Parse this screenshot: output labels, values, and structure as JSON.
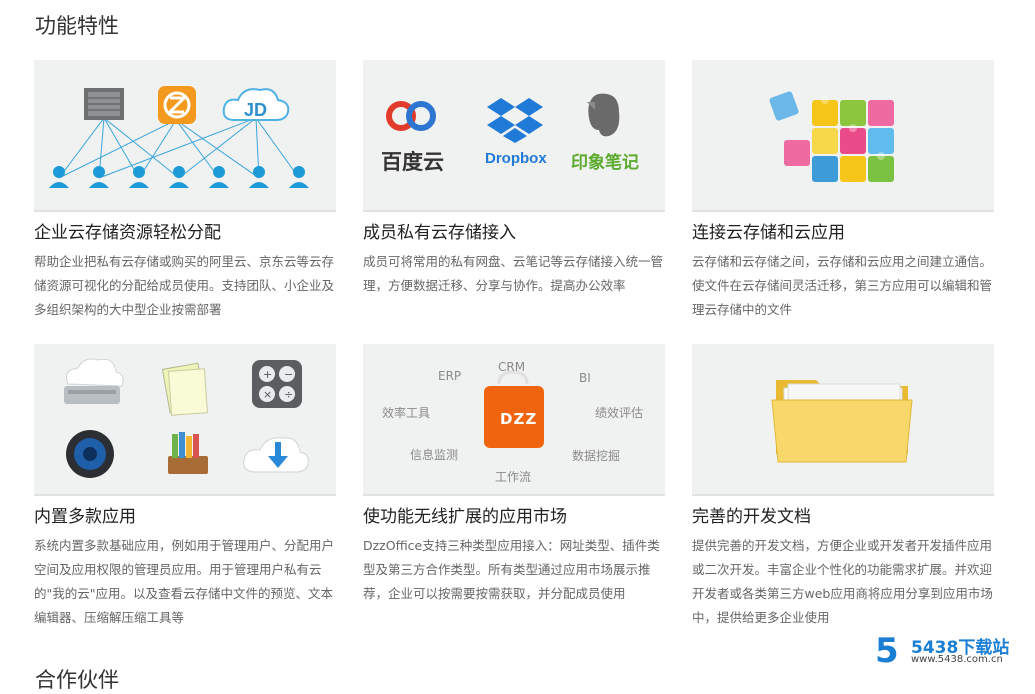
{
  "section_title": "功能特性",
  "cards": [
    {
      "title": "企业云存储资源轻松分配",
      "desc": "帮助企业把私有云存储或购买的阿里云、京东云等云存储资源可视化的分配给成员使用。支持团队、小企业及多组织架构的大中型企业按需部署",
      "image": {
        "icons": [
          "server-icon",
          "dzz-icon",
          "jd-cloud-icon",
          "user-icon"
        ],
        "logo_text": "JD"
      }
    },
    {
      "title": "成员私有云存储接入",
      "desc": "成员可将常用的私有网盘、云笔记等云存储接入统一管理，方便数据迁移、分享与协作。提高办公效率",
      "image": {
        "logos": [
          {
            "name": "baidu-cloud-logo",
            "text": "百度云",
            "color": "#333333"
          },
          {
            "name": "dropbox-logo",
            "text": "Dropbox",
            "color": "#1f7ad8"
          },
          {
            "name": "evernote-logo",
            "text": "印象笔记",
            "color": "#5cab2e"
          }
        ]
      }
    },
    {
      "title": "连接云存储和云应用",
      "desc": "云存储和云存储之间，云存储和云应用之间建立通信。使文件在云存储间灵活迁移，第三方应用可以编辑和管理云存储中的文件",
      "image": {
        "icons": [
          "puzzle-icon"
        ]
      }
    },
    {
      "title": "内置多款应用",
      "desc": "系统内置多款基础应用，例如用于管理用户、分配用户空间及应用权限的管理员应用。用于管理用户私有云的\"我的云\"应用。以及查看云存储中文件的预览、文本编辑器、压缩解压缩工具等",
      "image": {
        "icons": [
          "cloud-drive-icon",
          "notepad-icon",
          "calculator-icon",
          "speaker-icon",
          "bookshelf-icon",
          "cloud-download-icon"
        ]
      }
    },
    {
      "title": "使功能无线扩展的应用市场",
      "desc": "DzzOffice支持三种类型应用接入：网址类型、插件类型及第三方合作类型。所有类型通过应用市场展示推荐，企业可以按需要按需获取，并分配成员使用",
      "image": {
        "center_label": "DZZ",
        "labels": [
          "CRM",
          "ERP",
          "BI",
          "效率工具",
          "绩效评估",
          "信息监测",
          "数据挖掘",
          "工作流"
        ]
      }
    },
    {
      "title": "完善的开发文档",
      "desc": "提供完善的开发文档，方便企业或开发者开发插件应用或二次开发。丰富企业个性化的功能需求扩展。并欢迎开发者或各类第三方web应用商将应用分享到应用市场中，提供给更多企业使用",
      "image": {
        "icons": [
          "folder-icon"
        ]
      }
    }
  ],
  "next_section_title": "合作伙伴",
  "watermark": {
    "digit": "5",
    "text": "5438下载站",
    "url": "www.5438.com.cn"
  },
  "colors": {
    "accent_blue": "#1a9ad6",
    "dzz_orange": "#f0640f",
    "thumb_bg": "#f0f1f1"
  }
}
